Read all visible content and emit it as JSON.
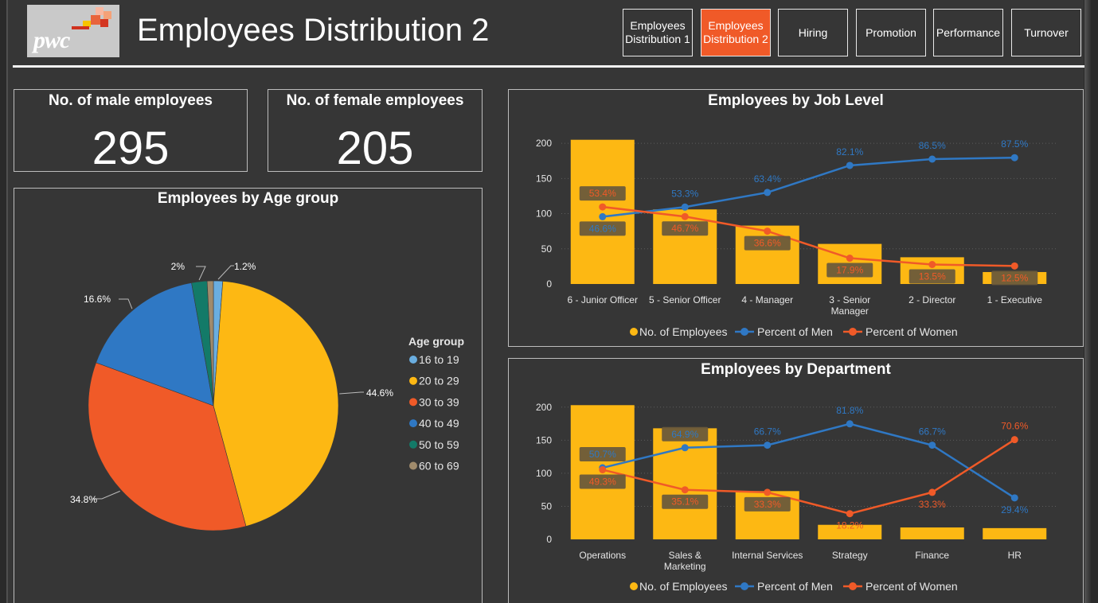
{
  "header": {
    "title": "Employees Distribution 2",
    "logo_text": "pwc",
    "nav": [
      {
        "label_line1": "Employees",
        "label_line2": "Distribution 1",
        "active": false
      },
      {
        "label_line1": "Employees",
        "label_line2": "Distribution 2",
        "active": true
      },
      {
        "label_line1": "Hiring",
        "label_line2": "",
        "active": false
      },
      {
        "label_line1": "Promotion",
        "label_line2": "",
        "active": false
      },
      {
        "label_line1": "Performance",
        "label_line2": "",
        "active": false
      },
      {
        "label_line1": "Turnover",
        "label_line2": "",
        "active": false
      }
    ]
  },
  "kpis": {
    "male": {
      "title": "No. of male employees",
      "value": "295"
    },
    "female": {
      "title": "No. of female employees",
      "value": "205"
    }
  },
  "colors": {
    "bar": "#fdb813",
    "men": "#2f78c4",
    "women": "#f05a28",
    "accent": "#f05a28"
  },
  "chart_data": [
    {
      "id": "age",
      "type": "pie",
      "title": "Employees by Age group",
      "legend_title": "Age group",
      "legend_position": "right",
      "slices": [
        {
          "label": "16 to 19",
          "value": 1.2,
          "value_label": "1.2%",
          "color": "#6aaee0"
        },
        {
          "label": "20 to 29",
          "value": 44.6,
          "value_label": "44.6%",
          "color": "#fdb813"
        },
        {
          "label": "30 to 39",
          "value": 34.8,
          "value_label": "34.8%",
          "color": "#f05a28"
        },
        {
          "label": "40 to 49",
          "value": 16.6,
          "value_label": "16.6%",
          "color": "#2f78c4"
        },
        {
          "label": "50 to 59",
          "value": 2,
          "value_label": "2%",
          "color": "#137a68"
        },
        {
          "label": "60 to 69",
          "value": 0.8,
          "value_label": "",
          "color": "#a08b6c"
        }
      ]
    },
    {
      "id": "job",
      "type": "bar",
      "title": "Employees by Job Level",
      "categories": [
        [
          "6 - Junior Officer"
        ],
        [
          "5 - Senior Officer"
        ],
        [
          "4 - Manager"
        ],
        [
          "3 - Senior",
          "Manager"
        ],
        [
          "2 - Director"
        ],
        [
          "1 - Executive"
        ]
      ],
      "ylim": [
        0,
        225
      ],
      "yticks": [
        0,
        50,
        100,
        150,
        200
      ],
      "grid": true,
      "legend_position": "bottom",
      "series": [
        {
          "name": "No. of Employees",
          "kind": "bar",
          "values": [
            205,
            106,
            83,
            57,
            38,
            17
          ]
        },
        {
          "name": "Percent of Men",
          "kind": "line",
          "values": [
            46.6,
            53.3,
            63.4,
            82.1,
            86.5,
            87.5
          ],
          "labels": [
            "46.6%",
            "53.3%",
            "63.4%",
            "82.1%",
            "86.5%",
            "87.5%"
          ]
        },
        {
          "name": "Percent of Women",
          "kind": "line",
          "values": [
            53.4,
            46.7,
            36.6,
            17.9,
            13.5,
            12.5
          ],
          "labels": [
            "53.4%",
            "46.7%",
            "36.6%",
            "17.9%",
            "13.5%",
            "12.5%"
          ]
        }
      ]
    },
    {
      "id": "dept",
      "type": "bar",
      "title": "Employees by Department",
      "categories": [
        [
          "Operations"
        ],
        [
          "Sales &",
          "Marketing"
        ],
        [
          "Internal Services"
        ],
        [
          "Strategy"
        ],
        [
          "Finance"
        ],
        [
          "HR"
        ]
      ],
      "ylim": [
        0,
        225
      ],
      "yticks": [
        0,
        50,
        100,
        150,
        200
      ],
      "grid": true,
      "legend_position": "bottom",
      "series": [
        {
          "name": "No. of Employees",
          "kind": "bar",
          "values": [
            203,
            168,
            73,
            22,
            18,
            17
          ]
        },
        {
          "name": "Percent of Men",
          "kind": "line",
          "values": [
            50.7,
            64.9,
            66.7,
            81.8,
            66.7,
            29.4
          ],
          "labels": [
            "50.7%",
            "64.9%",
            "66.7%",
            "81.8%",
            "66.7%",
            "29.4%"
          ]
        },
        {
          "name": "Percent of Women",
          "kind": "line",
          "values": [
            49.3,
            35.1,
            33.3,
            18.2,
            33.3,
            70.6
          ],
          "labels": [
            "49.3%",
            "35.1%",
            "33.3%",
            "18.2%",
            "33.3%",
            "70.6%"
          ]
        }
      ]
    }
  ]
}
